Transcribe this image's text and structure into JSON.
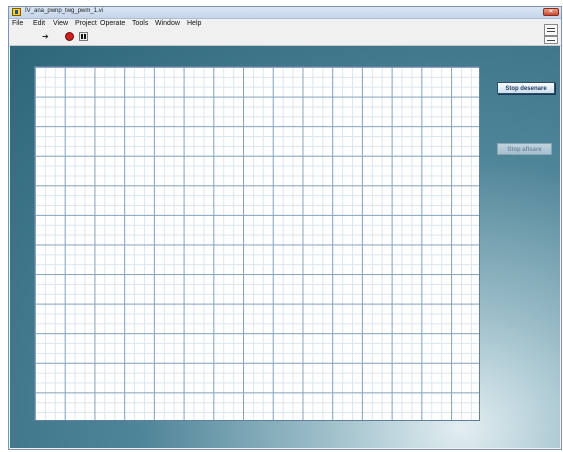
{
  "window": {
    "title": "IV_ana_pwnp_twg_pwm_1.vi",
    "close_label": "✕"
  },
  "menu": {
    "items": [
      "File",
      "Edit",
      "View",
      "Project",
      "Operate",
      "Tools",
      "Window",
      "Help"
    ]
  },
  "toolbar": {
    "run_icon": "run-arrow-icon",
    "stop_icon": "abort-icon",
    "pause_icon": "pause-icon",
    "run_glyph": "➔"
  },
  "panel": {
    "background_color": "#2d6579",
    "grid": {
      "major_columns": 15,
      "major_rows": 12,
      "minor_per_major": 3
    },
    "buttons": {
      "stop_drawing": "Stop desenare",
      "stop_display": "Stop afisare"
    }
  }
}
